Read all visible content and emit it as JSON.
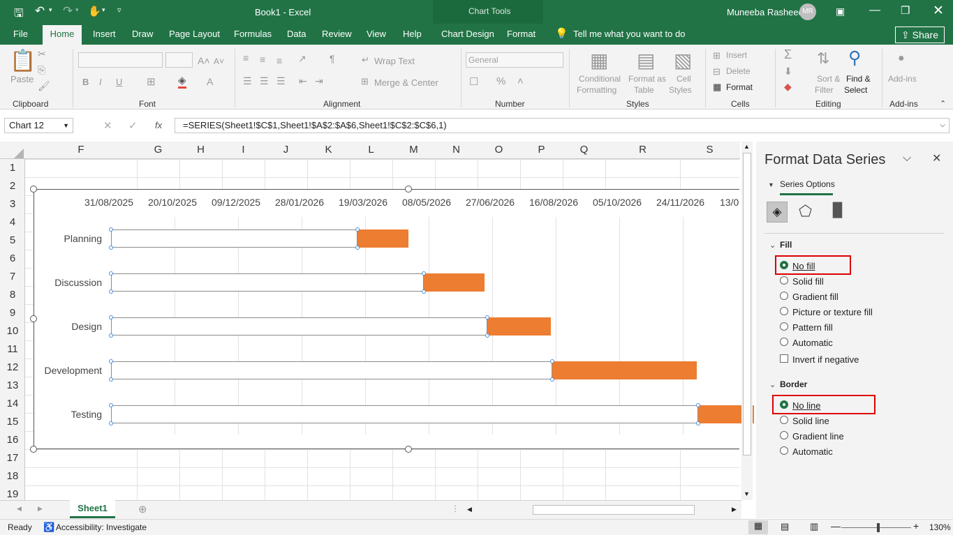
{
  "window": {
    "doc_title": "Book1 - Excel",
    "chart_tools": "Chart Tools",
    "user_name": "Muneeba Rasheed",
    "user_initials": "MR"
  },
  "tabs": [
    "File",
    "Home",
    "Insert",
    "Draw",
    "Page Layout",
    "Formulas",
    "Data",
    "Review",
    "View",
    "Help",
    "Chart Design",
    "Format"
  ],
  "tell_me": "Tell me what you want to do",
  "share": "Share",
  "ribbon": {
    "paste": "Paste",
    "wrap_text": "Wrap Text",
    "merge_center": "Merge & Center",
    "number_format": "General",
    "conditional": [
      "Conditional",
      "Formatting"
    ],
    "format_table": [
      "Format as",
      "Table"
    ],
    "cell_styles": [
      "Cell",
      "Styles"
    ],
    "insert": "Insert",
    "delete": "Delete",
    "format": "Format",
    "sort_filter": [
      "Sort &",
      "Filter"
    ],
    "find_select": [
      "Find &",
      "Select"
    ],
    "addins": "Add-ins",
    "groups": [
      "Clipboard",
      "Font",
      "Alignment",
      "Number",
      "Styles",
      "Cells",
      "Editing",
      "Add-ins"
    ]
  },
  "formula_bar": {
    "name_box": "Chart 12",
    "fx": "fx",
    "formula": "=SERIES(Sheet1!$C$1,Sheet1!$A$2:$A$6,Sheet1!$C$2:$C$6,1)"
  },
  "columns": [
    "F",
    "G",
    "H",
    "I",
    "J",
    "K",
    "L",
    "M",
    "N",
    "O",
    "P",
    "Q",
    "R",
    "S"
  ],
  "rows": [
    "1",
    "2",
    "3",
    "4",
    "5",
    "6",
    "7",
    "8",
    "9",
    "10",
    "11",
    "12",
    "13",
    "14",
    "15",
    "16",
    "17",
    "18",
    "19"
  ],
  "chart_data": {
    "type": "bar",
    "orientation": "horizontal",
    "stacked": true,
    "x_tick_labels": [
      "31/08/2025",
      "20/10/2025",
      "09/12/2025",
      "28/01/2026",
      "19/03/2026",
      "08/05/2026",
      "27/06/2026",
      "16/08/2026",
      "05/10/2026",
      "24/11/2026",
      "13/0"
    ],
    "xlim": [
      "2025-08-31",
      "2027-01-13"
    ],
    "categories": [
      "Planning",
      "Discussion",
      "Design",
      "Development",
      "Testing"
    ],
    "series": [
      {
        "role": "start (no fill, selected)",
        "values": [
          "2026-03-13",
          "2026-05-04",
          "2026-06-23",
          "2026-08-13",
          "2026-12-06"
        ]
      },
      {
        "role": "duration",
        "color": "#ed7d31",
        "values_days": [
          40,
          48,
          50,
          114,
          44
        ]
      }
    ],
    "axis_position": "top",
    "grid": true
  },
  "pane": {
    "title": "Format Data Series",
    "series_options": "Series Options",
    "fill_header": "Fill",
    "fill_options": [
      "No fill",
      "Solid fill",
      "Gradient fill",
      "Picture or texture fill",
      "Pattern fill",
      "Automatic"
    ],
    "fill_selected": "No fill",
    "invert": "Invert if negative",
    "border_header": "Border",
    "border_options": [
      "No line",
      "Solid line",
      "Gradient line",
      "Automatic"
    ],
    "border_selected": "No line"
  },
  "sheet": {
    "tab": "Sheet1"
  },
  "status": {
    "ready": "Ready",
    "accessibility": "Accessibility: Investigate",
    "zoom": "130%"
  }
}
